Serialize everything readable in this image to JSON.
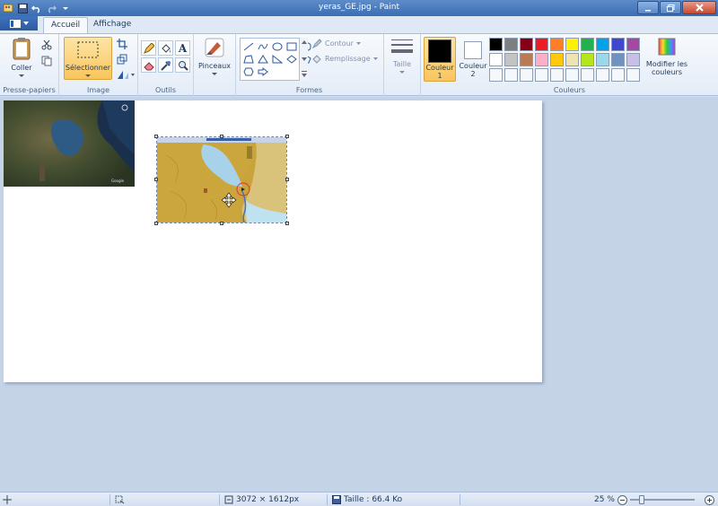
{
  "window": {
    "title": "yeras_GE.jpg - Paint"
  },
  "tabs": [
    "Accueil",
    "Affichage"
  ],
  "ribbon": {
    "groups": {
      "clipboard": "Presse-papiers",
      "image": "Image",
      "tools": "Outils",
      "shapes": "Formes",
      "colors": "Couleurs"
    },
    "buttons": {
      "paste": "Coller",
      "select": "Sélectionner",
      "brushes": "Pinceaux",
      "outline": "Contour",
      "fill": "Remplissage",
      "size": "Taille",
      "color1": "Couleur",
      "color1_num": "1",
      "color2": "Couleur",
      "color2_num": "2",
      "edit_colors_1": "Modifier les",
      "edit_colors_2": "couleurs"
    },
    "palette": [
      "#000000",
      "#7f7f7f",
      "#880015",
      "#ed1c24",
      "#ff7f27",
      "#fff200",
      "#22b14c",
      "#00a2e8",
      "#3f48cc",
      "#a349a4",
      "#ffffff",
      "#c3c3c3",
      "#b97a57",
      "#ffaec9",
      "#ffc90e",
      "#efe4b0",
      "#b5e61d",
      "#99d9ea",
      "#7092be",
      "#c8bfe7",
      "#f5f7fa",
      "#f5f7fa",
      "#f5f7fa",
      "#f5f7fa",
      "#f5f7fa",
      "#f5f7fa",
      "#f5f7fa",
      "#f5f7fa",
      "#f5f7fa",
      "#f5f7fa"
    ]
  },
  "status": {
    "dimensions": "3072 × 1612px",
    "size": "Taille : 66.4 Ko",
    "zoom": "25 %"
  }
}
